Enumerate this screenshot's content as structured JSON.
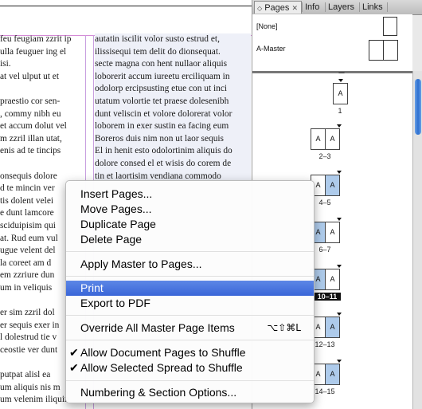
{
  "document": {
    "left_column": [
      "feu feugiam zzrit ip",
      "ulla feuguer ing el",
      "isi.",
      "at vel ulput ut et",
      "",
      "praestio cor sen-",
      ", commy nibh eu",
      "et accum dolut vel",
      "m zzril illan utat,",
      "enis ad te tincips",
      "",
      "onsequis dolore",
      "d te mincin ver",
      "tis dolent velei",
      "e dunt lamcore",
      "sciduipisim qui",
      "at. Rud eum vul",
      "ugue velent del",
      "la coreet am d",
      "em zzriure dun",
      "um in veliquis",
      "",
      "er sim zzril dol",
      "er sequis exer in",
      "l dolestrud tie v",
      "ceostie ver dunt",
      "",
      "putpat alisl ea",
      "um aliquis nis m",
      "um velenim iliquin"
    ],
    "right_column": [
      "autatin iscilit volor susto estrud et,",
      "ilissisequi tem delit do dionsequat.",
      "secte magna con hent nullaor aliquis",
      "loborerit accum iureetu erciliquam in",
      "odolorp ercipsusting etue con ut inci",
      "utatum volortie tet praese dolesenibh",
      "dunt veliscin et volore dolorerat volor",
      "loborem in exer sustin ea facing eum",
      "Boreros duis nim non ut laor sequis",
      "El in henit esto odolortinim aliquis do",
      "dolore consed el et wisis do corem de",
      "tin et laortisim vendiana commodo"
    ]
  },
  "panel": {
    "tabs": [
      {
        "label": "Pages",
        "close": "✕"
      },
      {
        "label": "Info"
      },
      {
        "label": "Layers"
      },
      {
        "label": "Links"
      }
    ],
    "masters": [
      {
        "label": "[None]"
      },
      {
        "label": "A-Master"
      }
    ],
    "page_letter": "A",
    "spreads": [
      {
        "label": "1",
        "selected": false
      },
      {
        "label": "2–3",
        "selected": false
      },
      {
        "label": "4–5",
        "selected": false
      },
      {
        "label": "6–7",
        "selected": false
      },
      {
        "label": "10–11",
        "selected": true
      },
      {
        "label": "12–13",
        "selected": false
      },
      {
        "label": "14–15",
        "selected": false
      }
    ]
  },
  "menu": {
    "items": {
      "insert": "Insert Pages...",
      "move": "Move Pages...",
      "duplicate": "Duplicate Page",
      "delete": "Delete Page",
      "apply_master": "Apply Master to Pages...",
      "print": "Print",
      "export_pdf": "Export to PDF",
      "override": "Override All Master Page Items",
      "override_shortcut": "⌥⇧⌘L",
      "allow_doc": "Allow Document Pages to Shuffle",
      "allow_spread": "Allow Selected Spread to Shuffle",
      "numbering": "Numbering & Section Options..."
    },
    "check": "✔",
    "highlighted": "Print"
  },
  "colors": {
    "selection": "#3a66d8",
    "page_selected": "#aecbeb",
    "scroll_thumb": "#2d6fd0",
    "margin_guide": "#d58bd6"
  }
}
